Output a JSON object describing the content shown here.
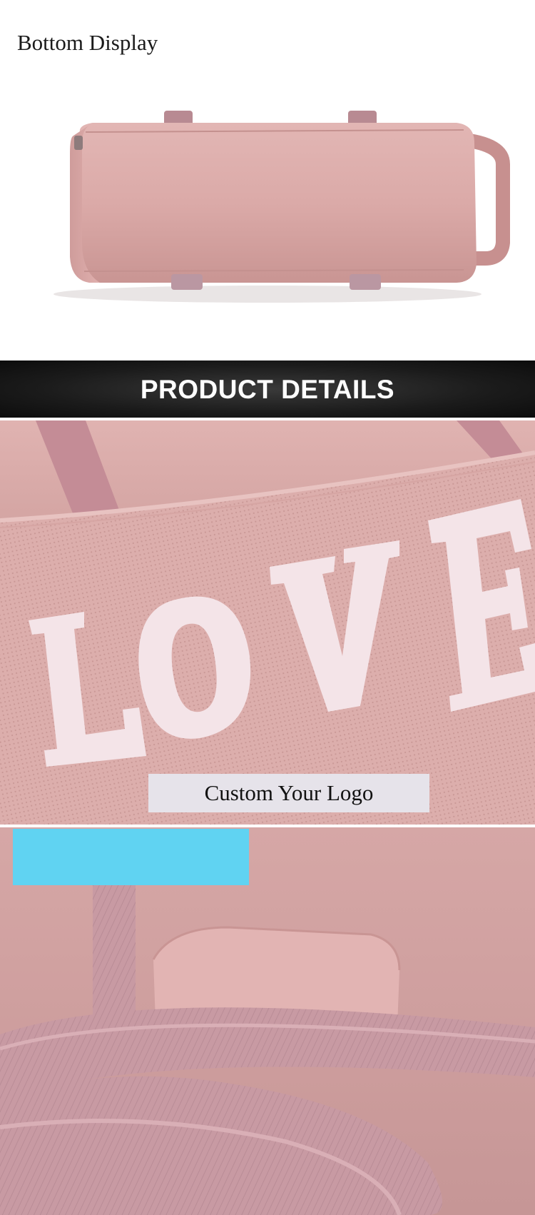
{
  "bottom_display": {
    "heading": "Bottom Display"
  },
  "details_banner": {
    "title": "PRODUCT DETAILS"
  },
  "logo_section": {
    "label": "Custom Your Logo",
    "print_text": "LOVE"
  },
  "colors": {
    "bag_pink": "#d9a9a9",
    "strap_pink": "#c99aa3",
    "banner_dark": "#1b1b1b",
    "label_bg": "#e6e3ea",
    "badge_blue": "#60d3f2"
  }
}
